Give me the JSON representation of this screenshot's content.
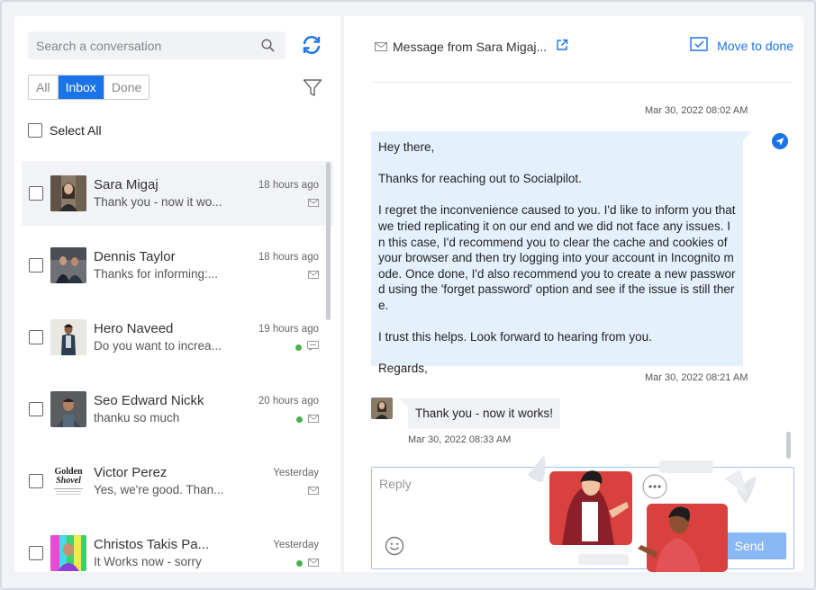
{
  "search": {
    "placeholder": "Search a conversation"
  },
  "tabs": [
    {
      "label": "All",
      "active": false
    },
    {
      "label": "Inbox",
      "active": true
    },
    {
      "label": "Done",
      "active": false
    }
  ],
  "select_all_label": "Select All",
  "conversations": [
    {
      "name": "Sara Migaj",
      "preview": "Thank you - now it wo...",
      "time": "18 hours ago",
      "status_dot": false,
      "channel_icon": "envelope-icon",
      "selected": true
    },
    {
      "name": "Dennis Taylor",
      "preview": "Thanks for informing:...",
      "time": "18 hours ago",
      "status_dot": false,
      "channel_icon": "envelope-icon",
      "selected": false
    },
    {
      "name": "Hero Naveed",
      "preview": "Do you want to increa...",
      "time": "19 hours ago",
      "status_dot": true,
      "channel_icon": "chat-bubble-icon",
      "selected": false
    },
    {
      "name": "Seo Edward Nickk",
      "preview": "thanku so much",
      "time": "20 hours ago",
      "status_dot": true,
      "channel_icon": "envelope-icon",
      "selected": false
    },
    {
      "name": "Victor Perez",
      "preview": "Yes, we're good. Than...",
      "time": "Yesterday",
      "status_dot": false,
      "channel_icon": "envelope-icon",
      "selected": false
    },
    {
      "name": "Christos Takis Pa...",
      "preview": "It Works now - sorry",
      "time": "Yesterday",
      "status_dot": true,
      "channel_icon": "envelope-icon",
      "selected": false
    }
  ],
  "victor_logo_text": [
    "Golden",
    "Shovel"
  ],
  "header": {
    "title": "Message from Sara Migaj...",
    "move_to_done": "Move to done"
  },
  "messages": {
    "outgoing_ts": "Mar 30, 2022 08:02 AM",
    "outgoing_paragraphs": [
      "Hey there,",
      "Thanks for reaching out to Socialpilot.",
      "I regret the inconvenience caused to you. I'd like to inform you that we tried replicating it on our end and we did not face any issues. In this case, I'd recommend you to clear the cache and cookies of your browser and then try logging into your account in Incognito mode. Once done, I'd also recommend you to create a new password using the 'forget password' option and see if the issue is still there.",
      "I trust this helps. Look forward to hearing from you.",
      "Regards,"
    ],
    "outgoing_sent_ts": "Mar 30, 2022 08:21 AM",
    "incoming_text": "Thank you - now it works!",
    "incoming_ts": "Mar 30, 2022 08:33 AM"
  },
  "reply": {
    "placeholder": "Reply",
    "send_label": "Send"
  },
  "colors": {
    "accent": "#1b73e8",
    "outgoing_bubble": "#e5f0fd",
    "incoming_bubble": "#f0f2f5",
    "online": "#4caf50",
    "illustration_red": "#d9413f"
  }
}
